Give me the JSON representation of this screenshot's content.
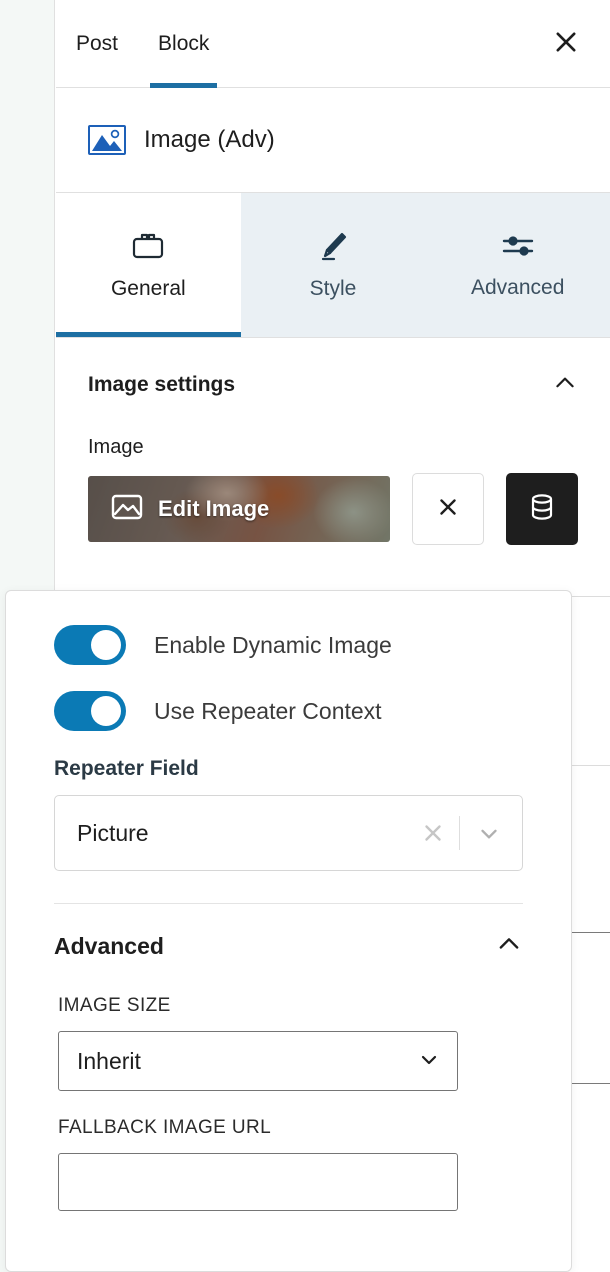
{
  "sidebar": {
    "tabs": [
      {
        "label": "Post",
        "active": false
      },
      {
        "label": "Block",
        "active": true
      }
    ],
    "close_icon": "close-icon",
    "block": {
      "icon": "image-block-icon",
      "title": "Image (Adv)"
    },
    "section_tabs": [
      {
        "label": "General",
        "icon": "toolbox-icon",
        "active": true
      },
      {
        "label": "Style",
        "icon": "paintbrush-icon",
        "active": false
      },
      {
        "label": "Advanced",
        "icon": "sliders-icon",
        "active": false
      }
    ],
    "image_settings": {
      "panel_title": "Image settings",
      "collapse_icon": "chevron-up-icon",
      "field_label": "Image",
      "edit_image_label": "Edit Image",
      "edit_image_icon": "image-icon",
      "clear_icon": "close-icon",
      "dynamic_icon": "database-icon"
    }
  },
  "popover": {
    "toggles": [
      {
        "label": "Enable Dynamic Image",
        "on": true
      },
      {
        "label": "Use Repeater Context",
        "on": true
      }
    ],
    "repeater_field": {
      "label": "Repeater Field",
      "value": "Picture",
      "clear_icon": "close-icon",
      "dropdown_icon": "chevron-down-icon"
    },
    "advanced": {
      "title": "Advanced",
      "collapse_icon": "chevron-up-icon",
      "image_size": {
        "label": "IMAGE SIZE",
        "value": "Inherit",
        "dropdown_icon": "chevron-down-icon"
      },
      "fallback_url": {
        "label": "FALLBACK IMAGE URL",
        "value": "",
        "placeholder": ""
      }
    }
  },
  "colors": {
    "accent": "#1d6fa3",
    "toggle_on": "#0b7ab5",
    "dark_button": "#1e1e1e",
    "canvas": "#f4f8f6",
    "section_tab_bg": "#eaf0f4"
  }
}
